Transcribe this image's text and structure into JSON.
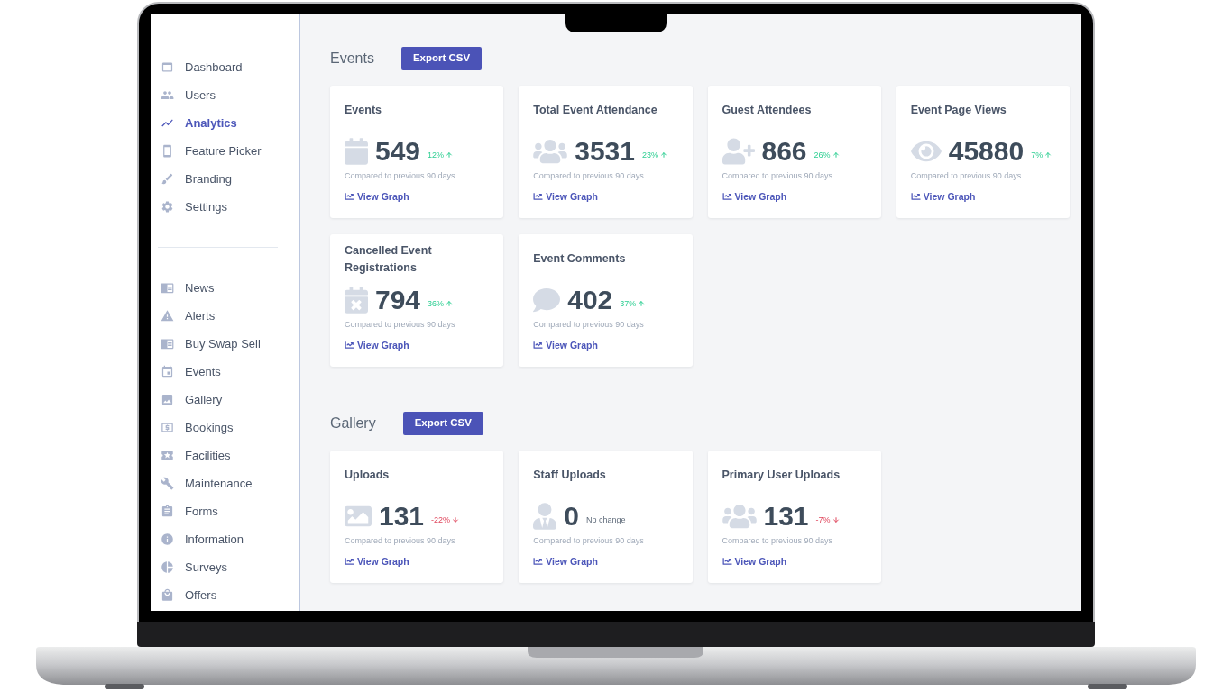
{
  "sidebar": {
    "groups": [
      {
        "items": [
          {
            "label": "Dashboard",
            "selected": false
          },
          {
            "label": "Users",
            "selected": false
          },
          {
            "label": "Analytics",
            "selected": true
          },
          {
            "label": "Feature Picker",
            "selected": false
          },
          {
            "label": "Branding",
            "selected": false
          },
          {
            "label": "Settings",
            "selected": false
          }
        ]
      },
      {
        "items": [
          {
            "label": "News",
            "selected": false
          },
          {
            "label": "Alerts",
            "selected": false
          },
          {
            "label": "Buy Swap Sell",
            "selected": false
          },
          {
            "label": "Events",
            "selected": false
          },
          {
            "label": "Gallery",
            "selected": false
          },
          {
            "label": "Bookings",
            "selected": false
          },
          {
            "label": "Facilities",
            "selected": false
          },
          {
            "label": "Maintenance",
            "selected": false
          },
          {
            "label": "Forms",
            "selected": false
          },
          {
            "label": "Information",
            "selected": false
          },
          {
            "label": "Surveys",
            "selected": false
          },
          {
            "label": "Offers",
            "selected": false
          }
        ]
      }
    ]
  },
  "sections": [
    {
      "title": "Events",
      "button": "Export CSV",
      "cards": [
        {
          "title": "Events",
          "value": "549",
          "change": "12%",
          "kind": "rise",
          "caption": "Compared to previous 90 days",
          "link": "View Graph"
        },
        {
          "title": "Total Event Attendance",
          "value": "3531",
          "change": "23%",
          "kind": "rise",
          "caption": "Compared to previous 90 days",
          "link": "View Graph"
        },
        {
          "title": "Guest Attendees",
          "value": "866",
          "change": "26%",
          "kind": "rise",
          "caption": "Compared to previous 90 days",
          "link": "View Graph"
        },
        {
          "title": "Event Page Views",
          "value": "45880",
          "change": "7%",
          "kind": "rise",
          "caption": "Compared to previous 90 days",
          "link": "View Graph"
        },
        {
          "title": "Cancelled Event Registrations",
          "value": "794",
          "change": "36%",
          "kind": "rise",
          "caption": "Compared to previous 90 days",
          "link": "View Graph"
        },
        {
          "title": "Event Comments",
          "value": "402",
          "change": "37%",
          "kind": "rise",
          "caption": "Compared to previous 90 days",
          "link": "View Graph"
        }
      ]
    },
    {
      "title": "Gallery",
      "button": "Export CSV",
      "cards": [
        {
          "title": "Uploads",
          "value": "131",
          "change": "-22%",
          "kind": "fall",
          "caption": "Compared to previous 90 days",
          "link": "View Graph"
        },
        {
          "title": "Staff Uploads",
          "value": "0",
          "change": "No change",
          "kind": "flat",
          "caption": "Compared to previous 90 days",
          "link": "View Graph"
        },
        {
          "title": "Primary User Uploads",
          "value": "131",
          "change": "-7%",
          "kind": "fall",
          "caption": "Compared to previous 90 days",
          "link": "View Graph"
        }
      ]
    }
  ]
}
